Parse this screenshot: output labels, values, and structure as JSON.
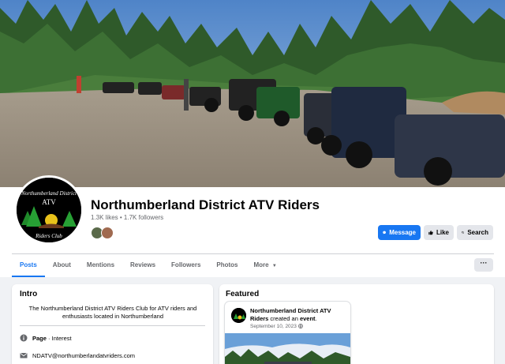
{
  "page": {
    "name": "Northumberland District ATV Riders",
    "stats": "1.3K likes • 1.7K followers",
    "avatar_text_top": "Northumberland District",
    "avatar_text_mid": "ATV",
    "avatar_text_bottom": "Riders Club"
  },
  "actions": {
    "message": "Message",
    "like": "Like",
    "search": "Search",
    "more_dots": "···"
  },
  "tabs": [
    "Posts",
    "About",
    "Mentions",
    "Reviews",
    "Followers",
    "Photos",
    "More"
  ],
  "intro": {
    "title": "Intro",
    "description": "The Northumberland District ATV Riders Club for ATV riders and enthusiasts located in Northumberland",
    "page_type_label": "Page",
    "page_type_sep": " · ",
    "page_type_value": "Interest",
    "email": "NDATV@northumberlandatvriders.com"
  },
  "featured": {
    "title": "Featured",
    "event": {
      "author": "Northumberland District ATV Riders",
      "action_pre": " created an ",
      "action_obj": "event",
      "action_post": ".",
      "date": "September 10, 2023"
    }
  },
  "colors": {
    "accent": "#1877f2",
    "secondary_button": "#e4e6eb",
    "background": "#f0f2f5"
  }
}
